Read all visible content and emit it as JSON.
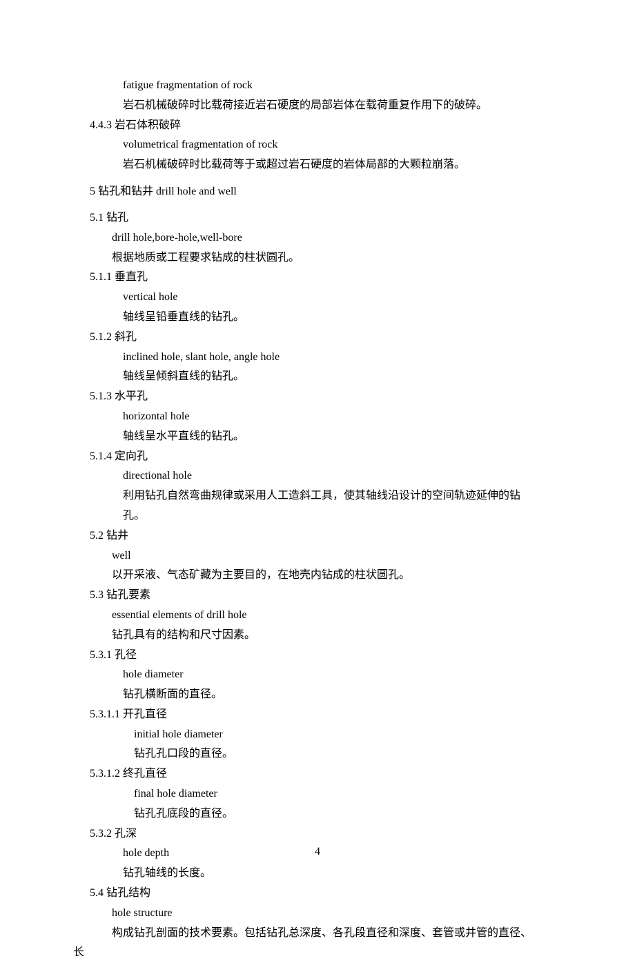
{
  "lines": [
    {
      "text": "fatigue fragmentation of rock",
      "indent": 2,
      "gap": false
    },
    {
      "text": "岩石机械破碎时比载荷接近岩石硬度的局部岩体在载荷重复作用下的破碎。",
      "indent": 2,
      "gap": false
    },
    {
      "text": "4.4.3 岩石体积破碎",
      "indent": 0,
      "gap": false
    },
    {
      "text": "volumetrical fragmentation of rock",
      "indent": 2,
      "gap": false
    },
    {
      "text": "岩石机械破碎时比载荷等于或超过岩石硬度的岩体局部的大颗粒崩落。",
      "indent": 2,
      "gap": false
    },
    {
      "text": "5 钻孔和钻井 drill hole and well",
      "indent": 0,
      "gap": true
    },
    {
      "text": "5.1 钻孔",
      "indent": 0,
      "gap": true
    },
    {
      "text": "drill hole,bore-hole,well-bore",
      "indent": 1,
      "gap": false
    },
    {
      "text": "根据地质或工程要求钻成的柱状圆孔。",
      "indent": 1,
      "gap": false
    },
    {
      "text": "5.1.1 垂直孔",
      "indent": 0,
      "gap": false
    },
    {
      "text": "vertical hole",
      "indent": 2,
      "gap": false
    },
    {
      "text": "轴线呈铅垂直线的钻孔。",
      "indent": 2,
      "gap": false
    },
    {
      "text": "5.1.2 斜孔",
      "indent": 0,
      "gap": false
    },
    {
      "text": "inclined hole, slant hole, angle hole",
      "indent": 2,
      "gap": false
    },
    {
      "text": "轴线呈倾斜直线的钻孔。",
      "indent": 2,
      "gap": false
    },
    {
      "text": "5.1.3 水平孔",
      "indent": 0,
      "gap": false
    },
    {
      "text": "horizontal hole",
      "indent": 2,
      "gap": false
    },
    {
      "text": "轴线呈水平直线的钻孔。",
      "indent": 2,
      "gap": false
    },
    {
      "text": "5.1.4 定向孔",
      "indent": 0,
      "gap": false
    },
    {
      "text": "directional hole",
      "indent": 2,
      "gap": false
    },
    {
      "text": "利用钻孔自然弯曲规律或采用人工造斜工具，使其轴线沿设计的空间轨迹延伸的钻",
      "indent": 2,
      "gap": false
    },
    {
      "text": "孔。",
      "indent": 2,
      "gap": false
    },
    {
      "text": "5.2 钻井",
      "indent": 0,
      "gap": false
    },
    {
      "text": "well",
      "indent": 1,
      "gap": false
    },
    {
      "text": "以开采液、气态矿藏为主要目的，在地壳内钻成的柱状圆孔。",
      "indent": 1,
      "gap": false
    },
    {
      "text": "5.3 钻孔要素",
      "indent": 0,
      "gap": false
    },
    {
      "text": "essential elements of drill hole",
      "indent": 1,
      "gap": false
    },
    {
      "text": "钻孔具有的结构和尺寸因素。",
      "indent": 1,
      "gap": false
    },
    {
      "text": "5.3.1 孔径",
      "indent": 0,
      "gap": false
    },
    {
      "text": "hole diameter",
      "indent": 2,
      "gap": false
    },
    {
      "text": "钻孔横断面的直径。",
      "indent": 2,
      "gap": false
    },
    {
      "text": "5.3.1.1 开孔直径",
      "indent": 0,
      "gap": false
    },
    {
      "text": "initial hole diameter",
      "indent": 3,
      "gap": false
    },
    {
      "text": "钻孔孔口段的直径。",
      "indent": 3,
      "gap": false
    },
    {
      "text": "5.3.1.2 终孔直径",
      "indent": 0,
      "gap": false
    },
    {
      "text": "final hole diameter",
      "indent": 3,
      "gap": false
    },
    {
      "text": "钻孔孔底段的直径。",
      "indent": 3,
      "gap": false
    },
    {
      "text": "5.3.2 孔深",
      "indent": 0,
      "gap": false
    },
    {
      "text": "hole depth",
      "indent": 2,
      "gap": false
    },
    {
      "text": "钻孔轴线的长度。",
      "indent": 2,
      "gap": false
    },
    {
      "text": "5.4 钻孔结构",
      "indent": 0,
      "gap": false
    },
    {
      "text": "hole structure",
      "indent": 1,
      "gap": false
    },
    {
      "text": "构成钻孔剖面的技术要素。包括钻孔总深度、各孔段直径和深度、套管或井管的直径、",
      "indent": 1,
      "gap": false
    },
    {
      "text": "长",
      "indent": -1,
      "gap": false
    }
  ],
  "page_number": "4"
}
